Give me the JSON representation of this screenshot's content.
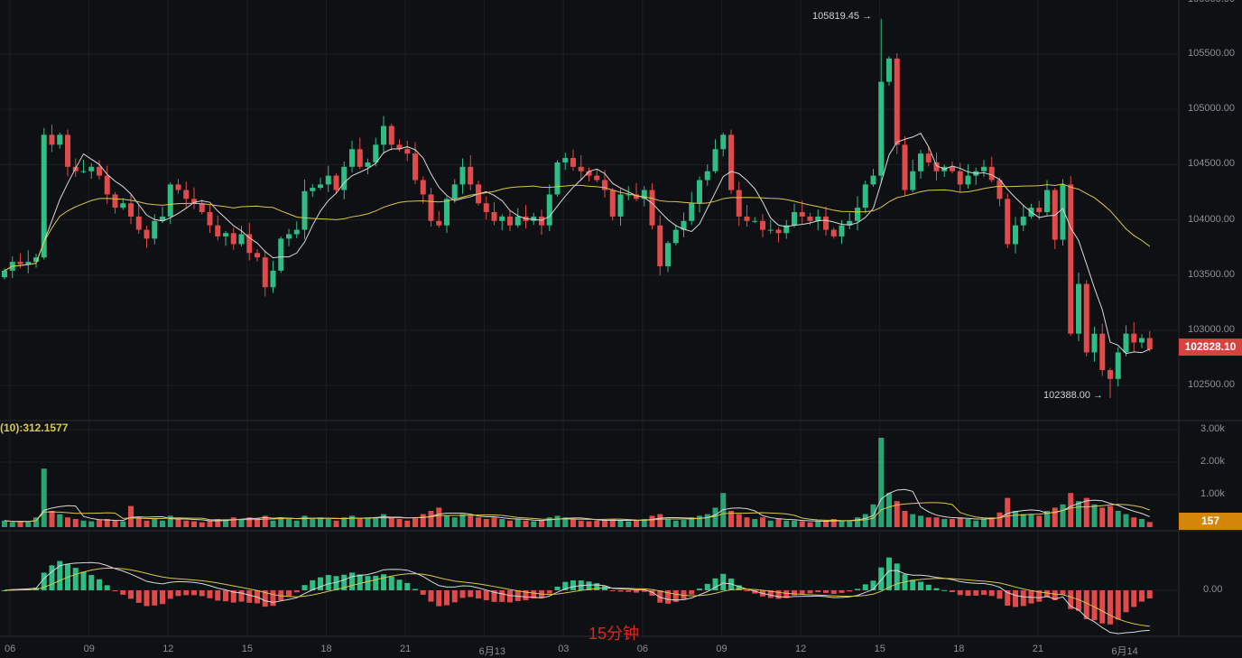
{
  "indicator_label": "(10):312.1577",
  "interval_label": "15分钟",
  "current_price_label": "102828.10",
  "current_volume_label": "157",
  "colors": {
    "up": "#2ebd85",
    "down": "#e04a4a",
    "ma_fast": "#d8d8d8",
    "ma_slow": "#d9c84a",
    "grid": "#1c1e23",
    "background": "#0f1013"
  },
  "chart_data": {
    "type": "candlestick",
    "price_axis": {
      "ticks": [
        "105500.00",
        "105000.00",
        "104500.00",
        "104000.00",
        "103500.00",
        "103000.00",
        "102500.00"
      ],
      "tick_values": [
        105500,
        105000,
        104500,
        104000,
        103500,
        103000,
        102500
      ],
      "range": [
        102200,
        105990
      ]
    },
    "volume_axis": {
      "ticks": [
        "3.00k",
        "2.00k",
        "1.00k"
      ],
      "tick_values": [
        3000,
        2000,
        1000
      ]
    },
    "macd_axis": {
      "ticks": [
        "0.00"
      ],
      "tick_values": [
        0
      ]
    },
    "x_ticks": [
      "06",
      "09",
      "12",
      "15",
      "18",
      "21",
      "6月13",
      "03",
      "06",
      "09",
      "12",
      "15",
      "18",
      "21",
      "6月14"
    ],
    "annotations": {
      "high": {
        "index": 111,
        "value": 105819.45,
        "label": "105819.45"
      },
      "low": {
        "index": 140,
        "value": 102388.0,
        "label": "102388.00"
      }
    },
    "close": [
      103540,
      103620,
      103600,
      103620,
      103660,
      104770,
      104680,
      104770,
      104480,
      104440,
      104440,
      104480,
      104400,
      104230,
      104110,
      104150,
      104030,
      103910,
      103830,
      103990,
      104030,
      104320,
      104270,
      104190,
      104150,
      104070,
      103950,
      103850,
      103880,
      103780,
      103870,
      103700,
      103660,
      103390,
      103540,
      103830,
      103870,
      103910,
      104260,
      104290,
      104320,
      104400,
      104270,
      104480,
      104640,
      104480,
      104520,
      104680,
      104850,
      104680,
      104640,
      104600,
      104360,
      104230,
      103990,
      103950,
      104190,
      104320,
      104480,
      104320,
      104150,
      104070,
      103990,
      104030,
      103950,
      104030,
      103990,
      104030,
      103950,
      104230,
      104520,
      104560,
      104480,
      104440,
      104400,
      104360,
      104270,
      104030,
      104230,
      104230,
      104190,
      104270,
      103950,
      103580,
      103790,
      103910,
      103990,
      104150,
      104360,
      104440,
      104640,
      104770,
      104270,
      104030,
      103990,
      103990,
      103910,
      103910,
      103880,
      103950,
      104070,
      104030,
      103990,
      104030,
      103910,
      103850,
      103950,
      103990,
      104110,
      104320,
      104400,
      105250,
      105460,
      104680,
      104270,
      104440,
      104600,
      104520,
      104440,
      104480,
      104440,
      104320,
      104400,
      104440,
      104480,
      104360,
      104190,
      103780,
      103950,
      104030,
      104110,
      104070,
      104270,
      103820,
      104320,
      102970,
      103420,
      102800,
      102970,
      102640,
      102560,
      102800,
      102970,
      102890,
      102930,
      102828.1
    ],
    "volume": [
      200,
      150,
      180,
      160,
      300,
      1800,
      500,
      400,
      300,
      250,
      200,
      180,
      220,
      250,
      200,
      180,
      650,
      300,
      200,
      250,
      200,
      350,
      250,
      200,
      180,
      150,
      200,
      250,
      220,
      300,
      250,
      300,
      280,
      350,
      200,
      300,
      250,
      200,
      350,
      250,
      300,
      250,
      200,
      300,
      350,
      250,
      300,
      280,
      400,
      300,
      250,
      200,
      300,
      400,
      500,
      600,
      350,
      300,
      400,
      350,
      300,
      250,
      300,
      250,
      200,
      250,
      200,
      180,
      200,
      300,
      350,
      300,
      250,
      200,
      180,
      200,
      220,
      250,
      200,
      180,
      200,
      250,
      350,
      400,
      250,
      200,
      220,
      300,
      350,
      400,
      600,
      1050,
      500,
      400,
      300,
      250,
      300,
      200,
      250,
      200,
      200,
      180,
      150,
      200,
      180,
      250,
      200,
      180,
      300,
      400,
      700,
      2750,
      1050,
      800,
      500,
      400,
      350,
      300,
      300,
      250,
      250,
      300,
      250,
      200,
      250,
      300,
      450,
      900,
      500,
      400,
      400,
      350,
      500,
      600,
      700,
      1050,
      800,
      900,
      700,
      600,
      650,
      500,
      400,
      300,
      250,
      157
    ]
  }
}
